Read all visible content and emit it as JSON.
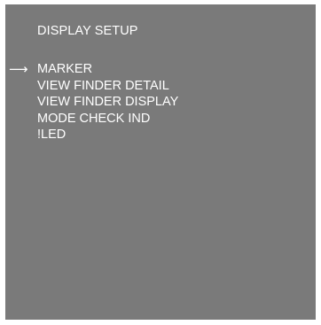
{
  "menu": {
    "title": "DISPLAY SETUP",
    "cursor_glyph": "⟶",
    "selected_index": 0,
    "items": [
      {
        "label": "MARKER"
      },
      {
        "label": "VIEW FINDER DETAIL"
      },
      {
        "label": "VIEW FINDER DISPLAY"
      },
      {
        "label": "MODE CHECK IND"
      },
      {
        "label": "!LED"
      }
    ]
  },
  "colors": {
    "screen_background": "#7a7a7a",
    "text": "#ffffff"
  }
}
